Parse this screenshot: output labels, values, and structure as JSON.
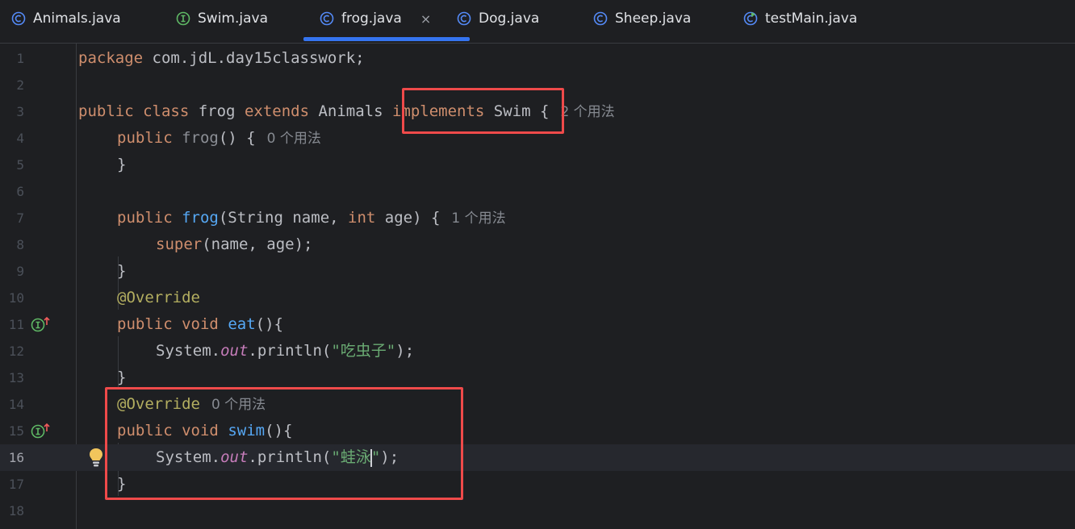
{
  "tabs": [
    {
      "label": "Animals.java",
      "icon": "class-icon"
    },
    {
      "label": "Swim.java",
      "icon": "interface-icon"
    },
    {
      "label": "frog.java",
      "icon": "class-icon",
      "active": true,
      "close": "×"
    },
    {
      "label": "Dog.java",
      "icon": "class-icon"
    },
    {
      "label": "Sheep.java",
      "icon": "class-icon"
    },
    {
      "label": "testMain.java",
      "icon": "runnable-class-icon"
    }
  ],
  "colors": {
    "background": "#1e1f22",
    "keyword": "#cf8e6d",
    "function": "#56a8f5",
    "string": "#6aab73",
    "annotation": "#b3ae60",
    "static_field": "#c77dbb",
    "tab_underline": "#3574f0",
    "highlight_box": "#ef4a4a"
  },
  "line_numbers": [
    "1",
    "2",
    "3",
    "4",
    "5",
    "6",
    "7",
    "8",
    "9",
    "10",
    "11",
    "12",
    "13",
    "14",
    "15",
    "16",
    "17",
    "18"
  ],
  "code": {
    "l1": {
      "kw": "package",
      "text": " com.jdL.day15classwork;"
    },
    "l3": {
      "kw1": "public",
      "kw2": "class",
      "name": " frog ",
      "kw3": "extends",
      "parent": " Animals ",
      "kw4": "implements",
      "iface": " Swim ",
      "brace": "{",
      "hint": "2 个用法"
    },
    "l4": {
      "kw": "public",
      "fn": "frog",
      "rest": "() {",
      "hint": "0 个用法"
    },
    "l5": {
      "text": "}"
    },
    "l7": {
      "kw": "public",
      "fn": "frog",
      "p1": "(String name, ",
      "kw2": "int",
      "p2": " age) {",
      "hint": "1 个用法"
    },
    "l8": {
      "kw": "super",
      "rest": "(name, age);"
    },
    "l9": {
      "text": "}"
    },
    "l10": {
      "ann": "@Override"
    },
    "l11": {
      "kw1": "public",
      "kw2": "void",
      "fn": "eat",
      "rest": "(){"
    },
    "l12": {
      "cls": "System.",
      "field": "out",
      "call": ".println(",
      "str": "\"吃虫子\"",
      "end": ");"
    },
    "l13": {
      "text": "}"
    },
    "l14": {
      "ann": "@Override",
      "hint": "0 个用法"
    },
    "l15": {
      "kw1": "public",
      "kw2": "void",
      "fn": "swim",
      "rest": "(){"
    },
    "l16": {
      "cls": "System.",
      "field": "out",
      "call": ".println(",
      "str1": "\"蛙泳",
      "str2": "\"",
      "end": ");"
    },
    "l17": {
      "text": "}"
    }
  }
}
